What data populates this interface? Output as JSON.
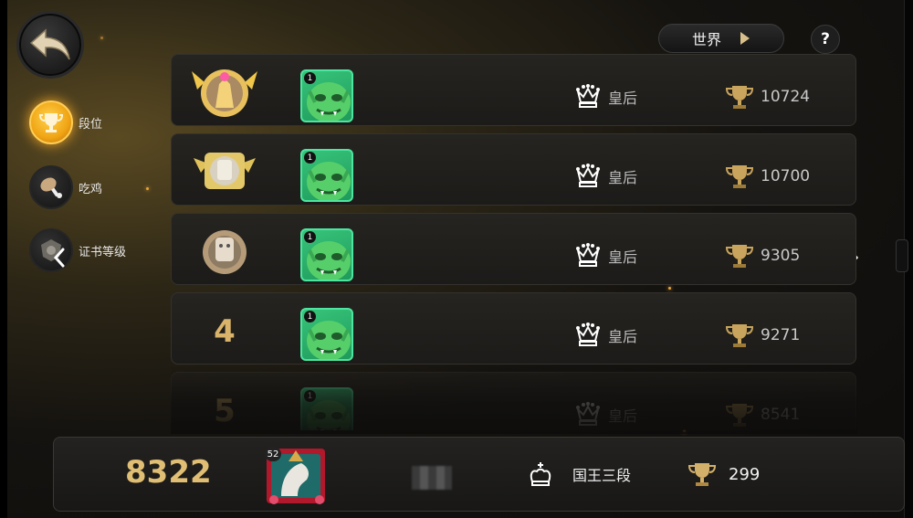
{
  "top_bar": {
    "world_label": "世界",
    "help_label": "?"
  },
  "side_tabs": [
    {
      "label": "段位",
      "icon": "trophy-icon",
      "active": true
    },
    {
      "label": "吃鸡",
      "icon": "chicken-leg-icon",
      "active": false
    },
    {
      "label": "证书等级",
      "icon": "certificate-icon",
      "active": false
    }
  ],
  "leaderboard": [
    {
      "rank": "1",
      "badge": "gold-rank-badge",
      "level": "1",
      "tier": "皇后",
      "score": "10724"
    },
    {
      "rank": "2",
      "badge": "silver-rank-badge",
      "level": "1",
      "tier": "皇后",
      "score": "10700"
    },
    {
      "rank": "3",
      "badge": "bronze-rank-badge",
      "level": "1",
      "tier": "皇后",
      "score": "9305"
    },
    {
      "rank": "4",
      "badge": "",
      "level": "1",
      "tier": "皇后",
      "score": "9271"
    },
    {
      "rank": "5",
      "badge": "",
      "level": "1",
      "tier": "皇后",
      "score": "8541"
    }
  ],
  "me": {
    "rank": "8322",
    "level": "52",
    "tier": "国王三段",
    "score": "299"
  },
  "colors": {
    "accent_gold": "#e0be74",
    "active_tab": "#f0a414",
    "avatar_green": "#37c47a"
  }
}
